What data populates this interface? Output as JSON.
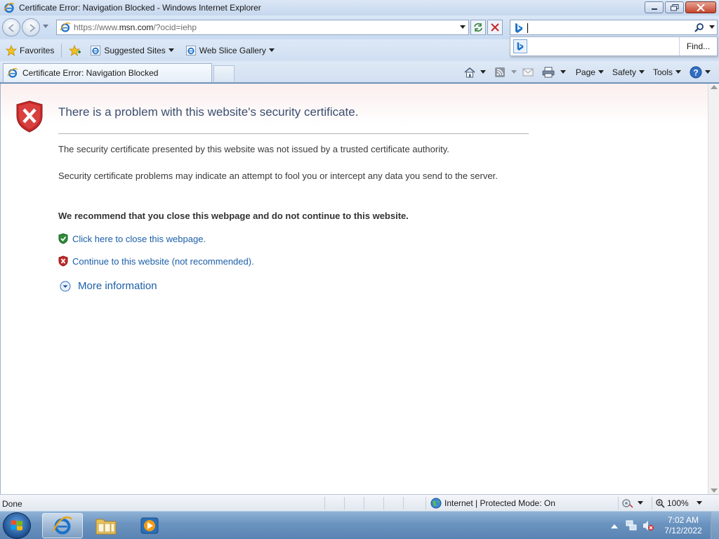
{
  "window": {
    "title": "Certificate Error: Navigation Blocked - Windows Internet Explorer"
  },
  "address": {
    "url_prefix": "https://www.",
    "url_host": "msn.com",
    "url_path": "/?ocid=iehp"
  },
  "search": {
    "value": "",
    "find_label": "Find..."
  },
  "favorites": {
    "favorites_label": "Favorites",
    "suggested_sites": "Suggested Sites",
    "web_slice_gallery": "Web Slice Gallery"
  },
  "tab": {
    "active_label": "Certificate Error: Navigation Blocked"
  },
  "commands": {
    "page": "Page",
    "safety": "Safety",
    "tools": "Tools"
  },
  "content": {
    "title": "There is a problem with this website's security certificate.",
    "para1": "The security certificate presented by this website was not issued by a trusted certificate authority.",
    "para2": "Security certificate problems may indicate an attempt to fool you or intercept any data you send to the server.",
    "recommend": "We recommend that you close this webpage and do not continue to this website.",
    "close_link": "Click here to close this webpage.",
    "continue_link": "Continue to this website (not recommended).",
    "more_info": "More information"
  },
  "status": {
    "text": "Done",
    "zone": "Internet | Protected Mode: On",
    "zoom": "100%"
  },
  "taskbar": {
    "time": "7:02 AM",
    "date": "7/12/2022"
  },
  "colors": {
    "link": "#1b5ea8",
    "title": "#3b4f70",
    "shield_red": "#c62828",
    "shield_green": "#2e8b3a"
  }
}
